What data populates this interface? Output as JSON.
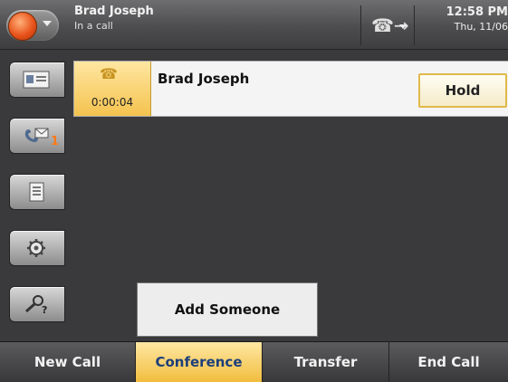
{
  "status": {
    "caller_name": "Brad Joseph",
    "call_state": "In a call",
    "time": "12:58 PM",
    "date": "Thu, 11/06"
  },
  "nav": {
    "items": [
      {
        "name": "contacts",
        "icon": "contact-card-icon"
      },
      {
        "name": "messages",
        "icon": "voicemail-icon",
        "badge": "1"
      },
      {
        "name": "directory",
        "icon": "directory-icon"
      },
      {
        "name": "settings",
        "icon": "gear-icon"
      },
      {
        "name": "help",
        "icon": "help-search-icon"
      }
    ]
  },
  "call": {
    "name": "Brad Joseph",
    "duration": "0:00:04",
    "hold_label": "Hold"
  },
  "menu": {
    "add_someone": "Add Someone"
  },
  "softkeys": {
    "new_call": "New Call",
    "conference": "Conference",
    "transfer": "Transfer",
    "end_call": "End Call",
    "active": "Conference"
  },
  "colors": {
    "accent_gold": "#f1bd3e",
    "presence_busy": "#e8541c",
    "badge_orange": "#ff7a1a"
  }
}
